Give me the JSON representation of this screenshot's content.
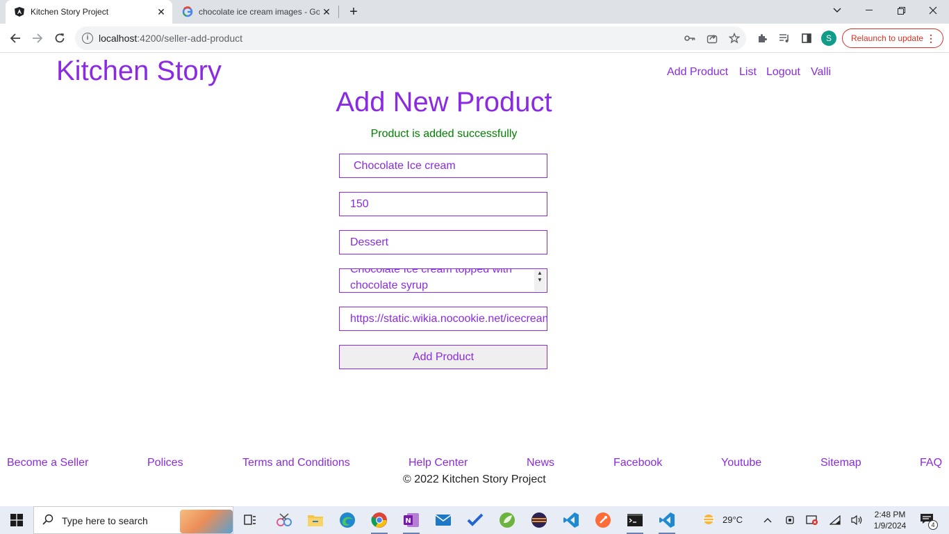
{
  "browser": {
    "tabs": [
      {
        "title": "Kitchen Story Project",
        "active": true,
        "icon": "angular-icon"
      },
      {
        "title": "chocolate ice cream images - Go",
        "active": false,
        "icon": "google-icon"
      }
    ],
    "new_tab": "+",
    "close_glyph": "✕",
    "url_host": "localhost",
    "url_path": ":4200/seller-add-product",
    "profile_initial": "S",
    "relaunch_label": "Relaunch to update"
  },
  "header": {
    "brand": "Kitchen Story",
    "nav": [
      "Add Product",
      "List",
      "Logout",
      "Valli"
    ]
  },
  "form": {
    "heading": "Add New Product",
    "success_message": "Product is added successfully",
    "name_value": "Chocolate Ice cream",
    "price_value": "150",
    "category_value": "Dessert",
    "description_value": "Chocolate Ice cream topped with chocolate syrup",
    "image_url_value": "https://static.wikia.nocookie.net/icecream",
    "submit_label": "Add Product"
  },
  "footer": {
    "links": [
      "Become a Seller",
      "Polices",
      "Terms and Conditions",
      "Help Center",
      "News",
      "Facebook",
      "Youtube",
      "Sitemap",
      "FAQ"
    ],
    "copyright": "© 2022 Kitchen Story Project"
  },
  "taskbar": {
    "search_placeholder": "Type here to search",
    "weather_temp": "29°C",
    "time": "2:48 PM",
    "date": "1/9/2024",
    "notification_count": "4"
  },
  "colors": {
    "brand": "#8a2be2",
    "success": "#008000",
    "relaunch": "#d93025"
  }
}
